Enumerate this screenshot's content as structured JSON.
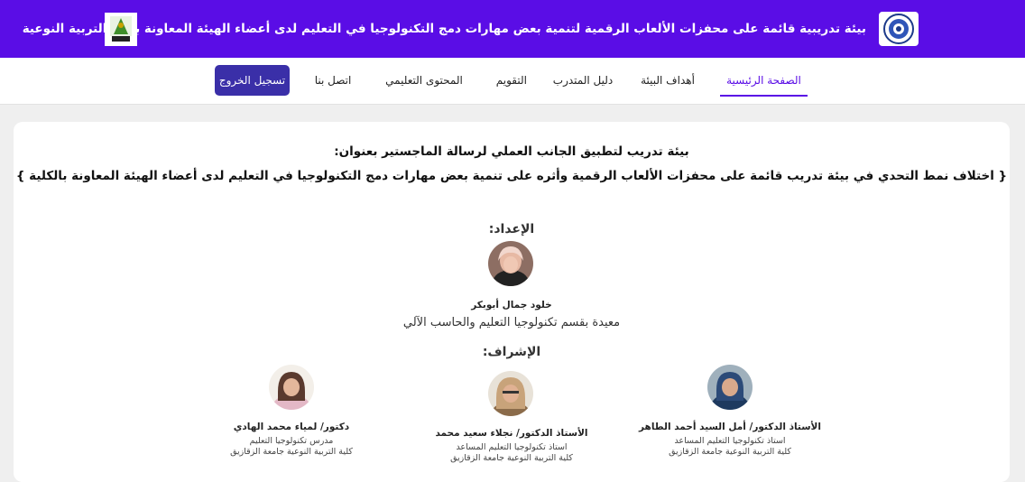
{
  "header": {
    "title": "بيئة تدريبية قائمة على محفزات الألعاب الرقمية لتنمية بعض مهارات دمج التكنولوجيا في التعليم لدى أعضاء الهيئة المعاونة بكلية التربية النوعية",
    "logo_right": "university-logo",
    "logo_left": "faculty-logo"
  },
  "nav": {
    "items": [
      {
        "label": "الصفحة الرئيسية",
        "active": true
      },
      {
        "label": "أهداف البيئة"
      },
      {
        "label": "دليل المتدرب"
      },
      {
        "label": "التقويم"
      },
      {
        "label": "المحتوى التعليمي"
      },
      {
        "label": "اتصل بنا"
      }
    ],
    "logout_label": "تسجيل الخروج"
  },
  "intro": {
    "line1": "بيئة تدريب لتطبيق الجانب العملي لرسالة الماجستير بعنوان:",
    "line2": "{ اختلاف نمط التحدي في بيئة تدريب قائمة على محفزات الألعاب الرقمية وأثره على تنمية بعض مهارات دمج التكنولوجيا في التعليم لدى أعضاء الهيئة المعاونة بالكلية }"
  },
  "preparation": {
    "label": "الإعداد:",
    "name": "خلود جمال أبوبكر",
    "role": "معيدة بقسم تكنولوجيا التعليم والحاسب الآلي"
  },
  "supervision": {
    "label": "الإشراف:",
    "people": [
      {
        "name": "الأستاذ الدكتور/ أمل السيد أحمد الطاهر",
        "role": "استاذ تكنولوجيا التعليم المساعد",
        "org": "كلية التربية النوعية جامعة الزقازيق"
      },
      {
        "name": "الأستاذ الدكتور/ نجلاء سعيد محمد",
        "role": "استاذ تكنولوجيا التعليم المساعد",
        "org": "كلية التربية النوعية جامعة الزقازيق"
      },
      {
        "name": "دكتور/ لمياء محمد الهادي",
        "role": "مدرس تكنولوجيا التعليم",
        "org": "كلية التربية النوعية جامعة الزقازيق"
      }
    ]
  },
  "colors": {
    "primary": "#5a0de6",
    "logout_button": "#3a2fa8",
    "page_bg": "#efefef",
    "card_bg": "#ffffff"
  }
}
